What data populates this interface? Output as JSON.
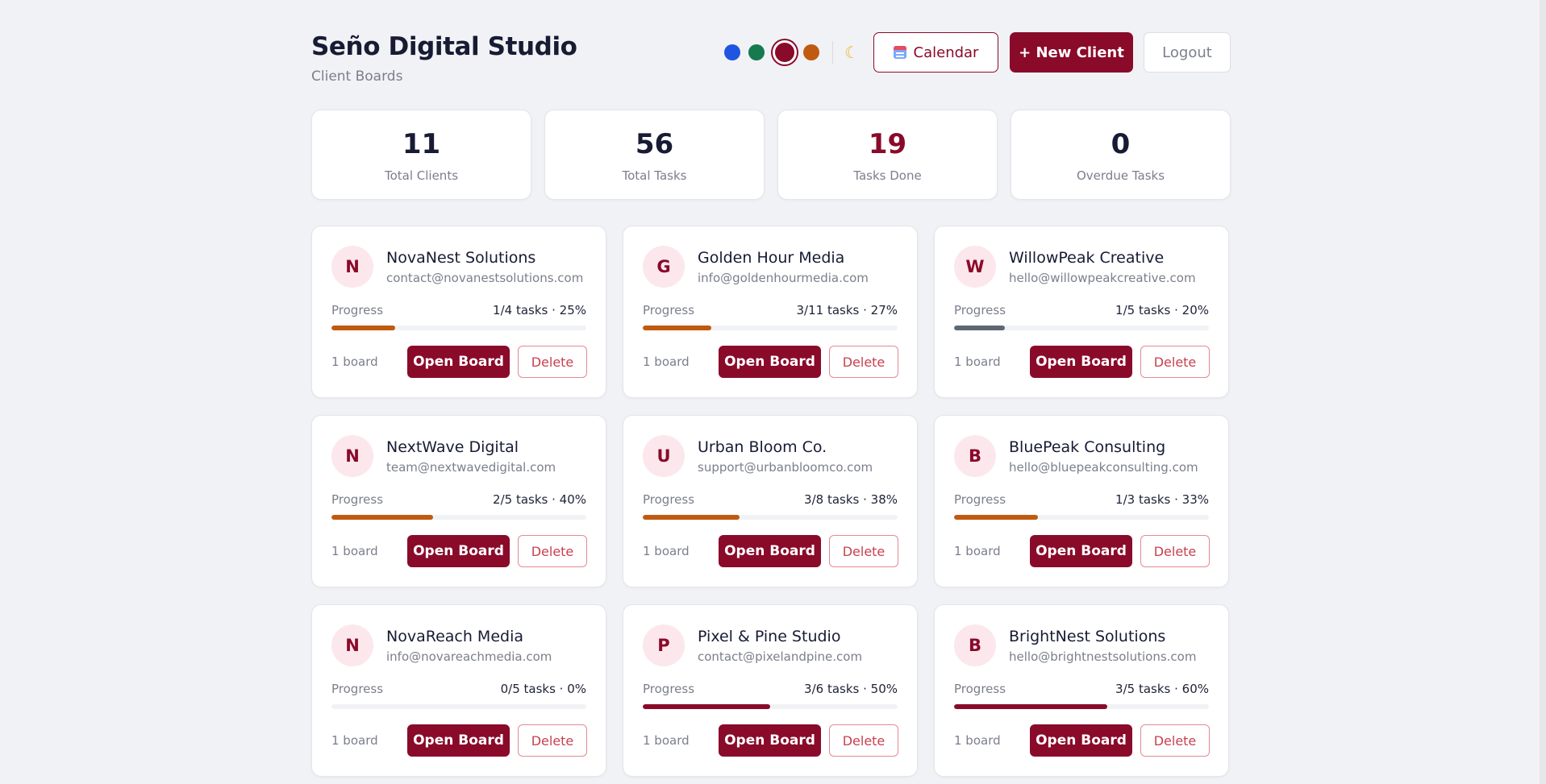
{
  "header": {
    "title": "Seño Digital Studio",
    "subtitle": "Client Boards",
    "theme_swatches": [
      {
        "name": "blue",
        "color": "#1f55e0",
        "active": false
      },
      {
        "name": "green",
        "color": "#157a4e",
        "active": false
      },
      {
        "name": "crimson",
        "color": "#8a0a2a",
        "active": true
      },
      {
        "name": "orange",
        "color": "#c05a10",
        "active": false
      }
    ],
    "theme_toggle_icon": "moon-icon",
    "calendar_label": "Calendar",
    "new_client_label": "+ New Client",
    "logout_label": "Logout"
  },
  "stats": [
    {
      "value": "11",
      "label": "Total Clients",
      "accent": false
    },
    {
      "value": "56",
      "label": "Total Tasks",
      "accent": false
    },
    {
      "value": "19",
      "label": "Tasks Done",
      "accent": true
    },
    {
      "value": "0",
      "label": "Overdue Tasks",
      "accent": false
    }
  ],
  "clients": [
    {
      "initial": "N",
      "name": "NovaNest Solutions",
      "email": "contact@novanestsolutions.com",
      "progress_label": "Progress",
      "progress": "1/4 tasks · 25%",
      "percent": 25,
      "bar_color": "#c05a10",
      "boards": "1 board",
      "open_label": "Open Board",
      "delete_label": "Delete"
    },
    {
      "initial": "G",
      "name": "Golden Hour Media",
      "email": "info@goldenhourmedia.com",
      "progress_label": "Progress",
      "progress": "3/11 tasks · 27%",
      "percent": 27,
      "bar_color": "#c05a10",
      "boards": "1 board",
      "open_label": "Open Board",
      "delete_label": "Delete"
    },
    {
      "initial": "W",
      "name": "WillowPeak Creative",
      "email": "hello@willowpeakcreative.com",
      "progress_label": "Progress",
      "progress": "1/5 tasks · 20%",
      "percent": 20,
      "bar_color": "#5f6773",
      "boards": "1 board",
      "open_label": "Open Board",
      "delete_label": "Delete"
    },
    {
      "initial": "N",
      "name": "NextWave Digital",
      "email": "team@nextwavedigital.com",
      "progress_label": "Progress",
      "progress": "2/5 tasks · 40%",
      "percent": 40,
      "bar_color": "#c05a10",
      "boards": "1 board",
      "open_label": "Open Board",
      "delete_label": "Delete"
    },
    {
      "initial": "U",
      "name": "Urban Bloom Co.",
      "email": "support@urbanbloomco.com",
      "progress_label": "Progress",
      "progress": "3/8 tasks · 38%",
      "percent": 38,
      "bar_color": "#c05a10",
      "boards": "1 board",
      "open_label": "Open Board",
      "delete_label": "Delete"
    },
    {
      "initial": "B",
      "name": "BluePeak Consulting",
      "email": "hello@bluepeakconsulting.com",
      "progress_label": "Progress",
      "progress": "1/3 tasks · 33%",
      "percent": 33,
      "bar_color": "#c05a10",
      "boards": "1 board",
      "open_label": "Open Board",
      "delete_label": "Delete"
    },
    {
      "initial": "N",
      "name": "NovaReach Media",
      "email": "info@novareachmedia.com",
      "progress_label": "Progress",
      "progress": "0/5 tasks · 0%",
      "percent": 0,
      "bar_color": "#c05a10",
      "boards": "1 board",
      "open_label": "Open Board",
      "delete_label": "Delete"
    },
    {
      "initial": "P",
      "name": "Pixel & Pine Studio",
      "email": "contact@pixelandpine.com",
      "progress_label": "Progress",
      "progress": "3/6 tasks · 50%",
      "percent": 50,
      "bar_color": "#8a0a2a",
      "boards": "1 board",
      "open_label": "Open Board",
      "delete_label": "Delete"
    },
    {
      "initial": "B",
      "name": "BrightNest Solutions",
      "email": "hello@brightnestsolutions.com",
      "progress_label": "Progress",
      "progress": "3/5 tasks · 60%",
      "percent": 60,
      "bar_color": "#8a0a2a",
      "boards": "1 board",
      "open_label": "Open Board",
      "delete_label": "Delete"
    }
  ]
}
